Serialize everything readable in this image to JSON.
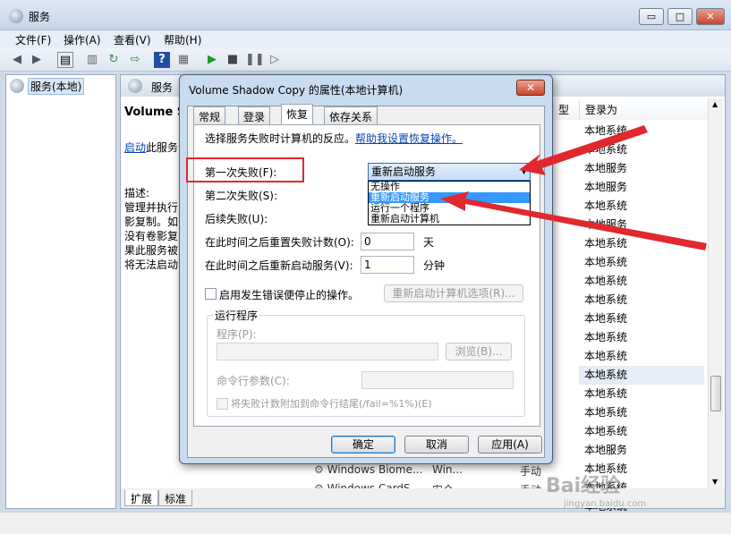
{
  "window": {
    "title": "服务",
    "min_glyph": "▭",
    "max_glyph": "□",
    "close_glyph": "✕"
  },
  "menu": [
    "文件(F)",
    "操作(A)",
    "查看(V)",
    "帮助(H)"
  ],
  "tree": {
    "root_label": "服务(本地)"
  },
  "pane": {
    "header_title": "服务",
    "ext_title": "Volume S",
    "ext_link": "启动",
    "ext_link_suffix": "此服务",
    "desc_label": "描述:",
    "desc_lines": "管理并执行\n影复制。如\n没有卷影复\n果此服务被\n将无法启动"
  },
  "columns": {
    "type": "型",
    "logon": "登录为"
  },
  "logon_rows": [
    "本地系统",
    "本地系统",
    "本地服务",
    "本地服务",
    "本地系统",
    "本地服务",
    "本地系统",
    "本地系统",
    "本地系统",
    "本地系统",
    "本地系统",
    "本地系统",
    "本地系统",
    "本地系统",
    "本地系统",
    "本地系统",
    "本地系统",
    "本地服务",
    "本地系统",
    "本地系统",
    "本地系统",
    "本地系统"
  ],
  "partial_rows": [
    {
      "name": "Windows Biome...",
      "desc": "Win...",
      "start": "手动"
    },
    {
      "name": "Windows CardS...",
      "desc": "安全",
      "start": "手动"
    }
  ],
  "bottom_tabs": [
    "扩展",
    "标准"
  ],
  "dialog": {
    "title": "Volume Shadow Copy 的属性(本地计算机)",
    "close": "✕",
    "tabs": [
      "常规",
      "登录",
      "恢复",
      "依存关系"
    ],
    "prompt": "选择服务失败时计算机的反应。",
    "help_link": "帮助我设置恢复操作。",
    "first_failure_label": "第一次失败(F):",
    "first_failure_value": "重新启动服务",
    "second_failure_label": "第二次失败(S):",
    "subsequent_failure_label": "后续失败(U):",
    "dropdown_options": [
      "无操作",
      "重新启动服务",
      "运行一个程序",
      "重新启动计算机"
    ],
    "reset_count_label": "在此时间之后重置失败计数(O):",
    "reset_count_value": "0",
    "reset_count_unit": "天",
    "restart_label": "在此时间之后重新启动服务(V):",
    "restart_value": "1",
    "restart_unit": "分钟",
    "enable_actions_label": "启用发生错误便停止的操作。",
    "restart_options_button": "重新启动计算机选项(R)...",
    "run_program_group": "运行程序",
    "program_label": "程序(P):",
    "browse_button": "浏览(B)...",
    "cmdline_label": "命令行参数(C):",
    "append_label": "将失败计数附加到命令行结尾(/fail=%1%)(E)",
    "ok": "确定",
    "cancel": "取消",
    "apply": "应用(A)"
  },
  "watermark": {
    "brand": "Bai经验",
    "url": "jingyan.baidu.com"
  },
  "colors": {
    "annotation_red": "#e0282e",
    "highlight_blue": "#3399ff",
    "link_blue": "#0645ad"
  }
}
